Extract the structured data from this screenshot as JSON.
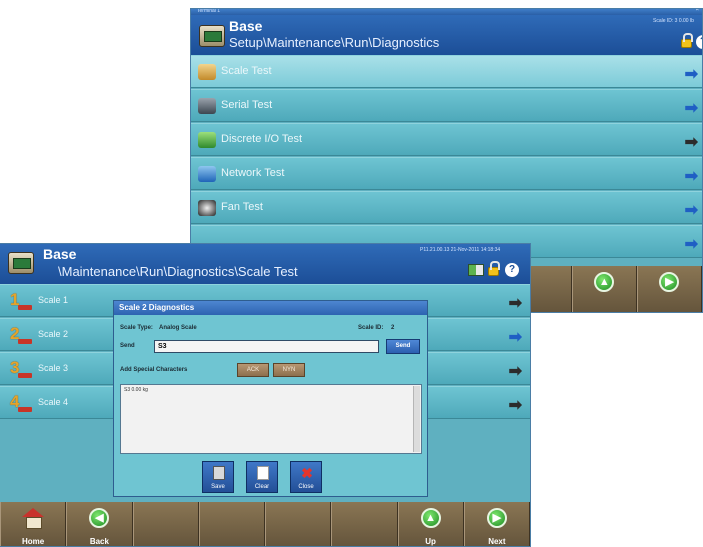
{
  "back_window": {
    "titlebar_text": "Terminal 1",
    "title": "Base",
    "path": "Setup\\Maintenance\\Run\\Diagnostics",
    "info_text": "Scale ID: 3 0.00 lb",
    "menu_items": [
      {
        "label": "Scale Test",
        "icon": "scale-icon",
        "arrow": "blue"
      },
      {
        "label": "Serial Test",
        "icon": "serial-icon",
        "arrow": "blue"
      },
      {
        "label": "Discrete I/O Test",
        "icon": "discrete-io-icon",
        "arrow": "dark"
      },
      {
        "label": "Network Test",
        "icon": "network-icon",
        "arrow": "blue"
      },
      {
        "label": "Fan Test",
        "icon": "fan-icon",
        "arrow": "blue"
      },
      {
        "label": "",
        "icon": "",
        "arrow": "blue"
      }
    ]
  },
  "front_window": {
    "title": "Base",
    "path": "\\Maintenance\\Run\\Diagnostics\\Scale Test",
    "info_text": "P11.21.00.13 21-Nov-2011 14:18:34",
    "scales": [
      {
        "number": "1",
        "label": "Scale 1",
        "arrow": "dark"
      },
      {
        "number": "2",
        "label": "Scale 2",
        "arrow": "blue"
      },
      {
        "number": "3",
        "label": "Scale 3",
        "arrow": "dark"
      },
      {
        "number": "4",
        "label": "Scale 4",
        "arrow": "dark"
      }
    ],
    "softkeys": [
      {
        "label": "Home",
        "icon": "home-icon"
      },
      {
        "label": "Back",
        "icon": "back-icon"
      },
      {
        "label": "",
        "icon": ""
      },
      {
        "label": "",
        "icon": ""
      },
      {
        "label": "",
        "icon": ""
      },
      {
        "label": "",
        "icon": ""
      },
      {
        "label": "Up",
        "icon": "up-icon"
      },
      {
        "label": "Next",
        "icon": "next-icon"
      }
    ]
  },
  "back_softkeys": [
    {
      "label": "",
      "icon": ""
    },
    {
      "label": "",
      "icon": "up-icon"
    },
    {
      "label": "",
      "icon": "next-icon"
    }
  ],
  "dialog": {
    "title": "Scale 2 Diagnostics",
    "scale_type_label": "Scale Type:",
    "scale_type_value": "Analog Scale",
    "scale_id_label": "Scale ID:",
    "scale_id_value": "2",
    "send_field_label": "Send",
    "send_field_value": "S3",
    "send_button": "Send",
    "special_chars_label": "Add Special Characters",
    "special_char_buttons": [
      "ACK",
      "NYN"
    ],
    "output_text": "S3  0.00 kg",
    "buttons": [
      {
        "label": "Save",
        "icon": "save-icon"
      },
      {
        "label": "Clear",
        "icon": "clear-icon"
      },
      {
        "label": "Close",
        "icon": "close-icon"
      }
    ]
  },
  "colors": {
    "header_blue": "#2f6bb8",
    "row_teal": "#5fb0c0",
    "softkey_brown": "#7a6647",
    "arrow_blue": "#1f5fc4"
  }
}
